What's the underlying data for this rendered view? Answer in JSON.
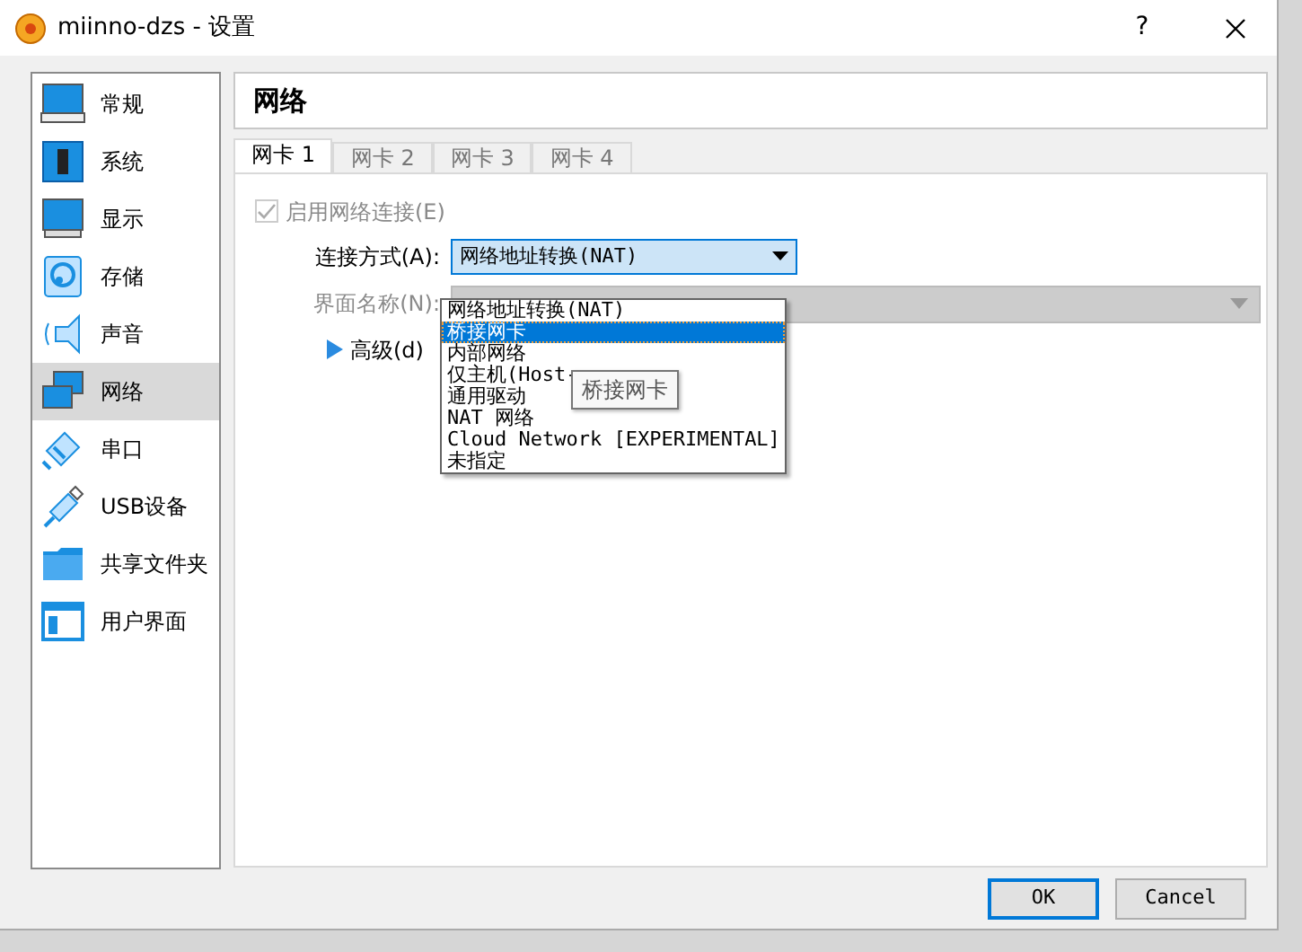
{
  "window": {
    "title": "miinno-dzs - 设置",
    "help": "?"
  },
  "sidebar": {
    "items": [
      {
        "kind": "monitor",
        "label": "常规",
        "selected": false
      },
      {
        "kind": "chip",
        "label": "系统",
        "selected": false
      },
      {
        "kind": "screen",
        "label": "显示",
        "selected": false
      },
      {
        "kind": "disk",
        "label": "存储",
        "selected": false
      },
      {
        "kind": "speaker",
        "label": "声音",
        "selected": false
      },
      {
        "kind": "network",
        "label": "网络",
        "selected": true
      },
      {
        "kind": "serial",
        "label": "串口",
        "selected": false
      },
      {
        "kind": "usb",
        "label": "USB设备",
        "selected": false
      },
      {
        "kind": "folder",
        "label": "共享文件夹",
        "selected": false
      },
      {
        "kind": "window",
        "label": "用户界面",
        "selected": false
      }
    ]
  },
  "section_title": "网络",
  "tabs": [
    {
      "label": "网卡 1",
      "selected": true
    },
    {
      "label": "网卡 2",
      "selected": false
    },
    {
      "label": "网卡 3",
      "selected": false
    },
    {
      "label": "网卡 4",
      "selected": false
    }
  ],
  "enable_checkbox": {
    "label": "启用网络连接(E)",
    "checked": true,
    "disabled": true
  },
  "attachment": {
    "label": "连接方式(A):",
    "value": "网络地址转换(NAT)",
    "options": [
      {
        "label": "网络地址转换(NAT)",
        "highlighted": false
      },
      {
        "label": "桥接网卡",
        "highlighted": true
      },
      {
        "label": "内部网络",
        "highlighted": false
      },
      {
        "label": "仅主机(Host-",
        "highlighted": false
      },
      {
        "label": "通用驱动",
        "highlighted": false
      },
      {
        "label": "NAT 网络",
        "highlighted": false
      },
      {
        "label": "Cloud Network [EXPERIMENTAL]",
        "highlighted": false
      },
      {
        "label": "未指定",
        "highlighted": false
      }
    ]
  },
  "interface": {
    "label": "界面名称(N):",
    "disabled": true
  },
  "advanced": {
    "label": "高级(d)",
    "expanded": false
  },
  "tooltip": "桥接网卡",
  "buttons": [
    {
      "label": "OK",
      "default": true
    },
    {
      "label": "Cancel",
      "default": false
    }
  ]
}
